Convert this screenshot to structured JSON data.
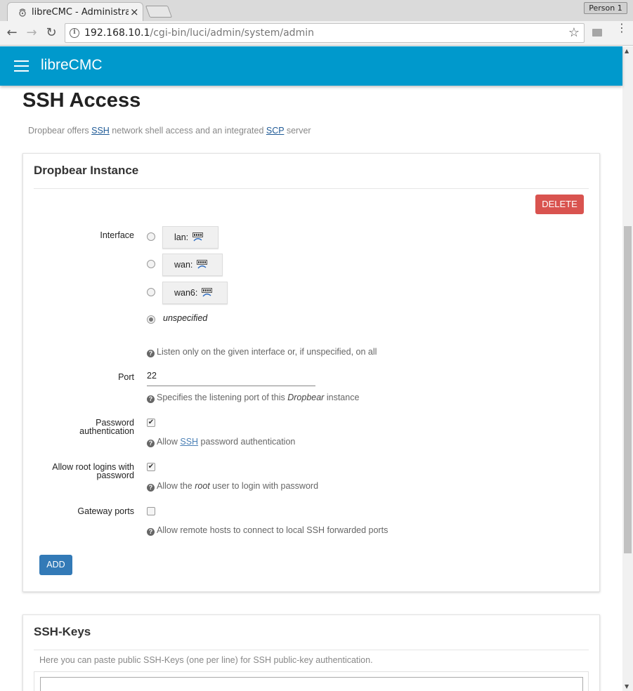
{
  "browser": {
    "tab_title": "libreCMC - Administrat",
    "tab_close": "×",
    "profile": "Person 1",
    "url_host": "192.168.10.1",
    "url_path": "/cgi-bin/luci/admin/system/admin",
    "back": "←",
    "forward": "→",
    "reload": "↻",
    "info": "i",
    "star": "☆",
    "menu": "⋮"
  },
  "header": {
    "brand": "libreCMC",
    "accent_color": "#0099cc"
  },
  "page": {
    "title": "SSH Access",
    "desc_prefix": "Dropbear offers",
    "desc_ssh": "SSH",
    "desc_middle": "network shell access and an integrated",
    "desc_scp": "SCP",
    "desc_suffix": "server"
  },
  "instance": {
    "title": "Dropbear Instance",
    "delete_label": "DELETE",
    "interface_label": "Interface",
    "interfaces": [
      {
        "label": "lan:",
        "selected": false
      },
      {
        "label": "wan:",
        "selected": false
      },
      {
        "label": "wan6:",
        "selected": false
      }
    ],
    "unspecified_label": "unspecified",
    "unspecified_selected": true,
    "interface_help": "Listen only on the given interface or, if unspecified, on all",
    "port_label": "Port",
    "port_value": "22",
    "port_help_prefix": "Specifies the listening port of this",
    "port_help_em": "Dropbear",
    "port_help_suffix": "instance",
    "password_label_line1": "Password",
    "password_label_line2": "authentication",
    "password_checked": true,
    "password_help_prefix": "Allow",
    "password_help_link": "SSH",
    "password_help_suffix": "password authentication",
    "root_label_line1": "Allow root logins with",
    "root_label_line2": "password",
    "root_checked": true,
    "root_help_prefix": "Allow the",
    "root_help_em": "root",
    "root_help_suffix": "user to login with password",
    "gateway_label": "Gateway ports",
    "gateway_checked": false,
    "gateway_help": "Allow remote hosts to connect to local SSH forwarded ports",
    "add_label": "ADD",
    "check_mark": "✔",
    "help_mark": "?"
  },
  "keys": {
    "title": "SSH-Keys",
    "description": "Here you can paste public SSH-Keys (one per line) for SSH public-key authentication.",
    "value": ""
  }
}
